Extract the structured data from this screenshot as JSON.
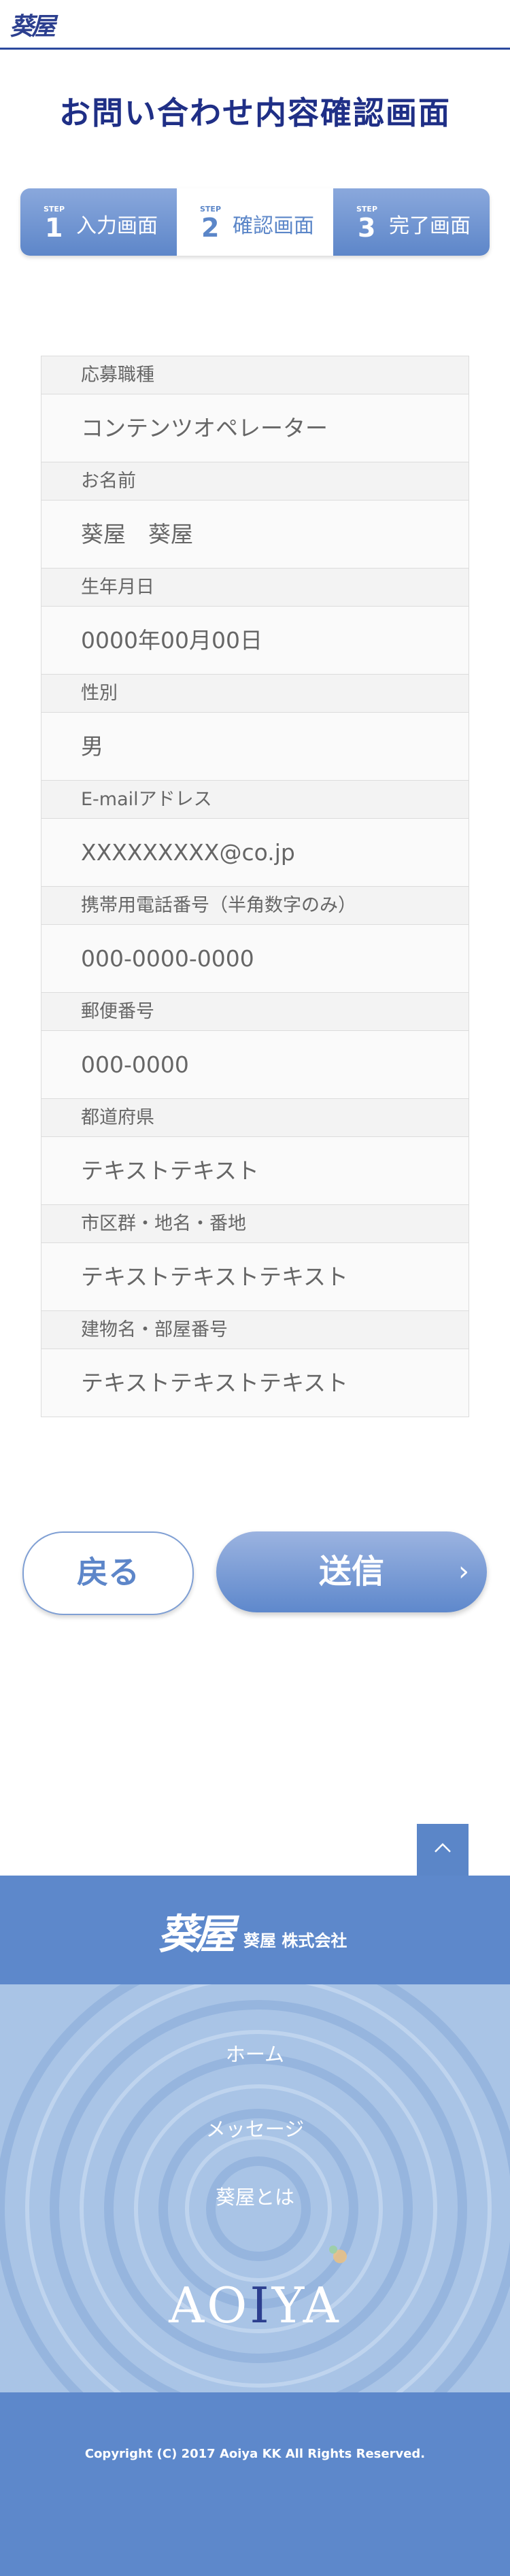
{
  "header": {
    "logo_text": "葵屋"
  },
  "page_title": "お問い合わせ内容確認画面",
  "steps": [
    {
      "label": "STEP",
      "number": "1",
      "text": "入力画面"
    },
    {
      "label": "STEP",
      "number": "2",
      "text": "確認画面"
    },
    {
      "label": "STEP",
      "number": "3",
      "text": "完了画面"
    }
  ],
  "form": [
    {
      "label": "応募職種",
      "value": "コンテンツオペレーター"
    },
    {
      "label": "お名前",
      "value": "葵屋　葵屋"
    },
    {
      "label": "生年月日",
      "value": "0000年00月00日"
    },
    {
      "label": "性別",
      "value": "男"
    },
    {
      "label": "E-mailアドレス",
      "value": "XXXXXXXXX@co.jp"
    },
    {
      "label": "携帯用電話番号（半角数字のみ）",
      "value": "000-0000-0000"
    },
    {
      "label": "郵便番号",
      "value": "000-0000"
    },
    {
      "label": "都道府県",
      "value": "テキストテキスト"
    },
    {
      "label": "市区群・地名・番地",
      "value": "テキストテキストテキスト"
    },
    {
      "label": "建物名・部屋番号",
      "value": "テキストテキストテキスト"
    }
  ],
  "buttons": {
    "back": "戻る",
    "send": "送信",
    "send_arrow": "›"
  },
  "footer": {
    "logo_text": "葵屋",
    "company": "葵屋 株式会社",
    "nav": [
      "ホーム",
      "メッセージ",
      "葵屋とは"
    ],
    "brand_parts": [
      "AO",
      "I",
      "YA"
    ],
    "copyright": "Copyright (C) 2017 Aoiya KK All Rights Reserved."
  },
  "icons": {
    "to_top": "chevron-up-icon"
  },
  "colors": {
    "navy": "#1f2f86",
    "accent": "#5d88cb"
  }
}
